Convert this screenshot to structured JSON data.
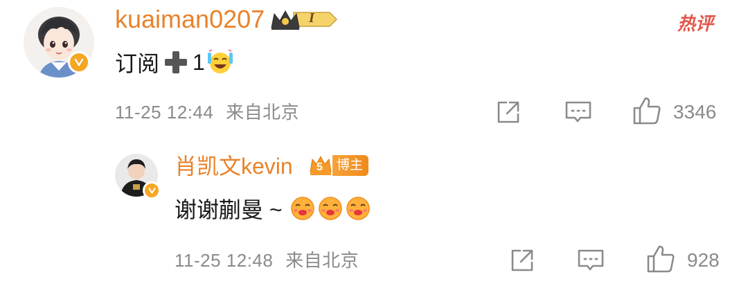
{
  "comment": {
    "username": "kuaiman0207",
    "level_badge": "I",
    "hot_label": "热评",
    "text": "订阅",
    "text_suffix": "1",
    "timestamp": "11-25 12:44",
    "location": "来自北京",
    "like_count": "3346",
    "colors": {
      "username": "#e8822a",
      "verified": "#f5a623",
      "hot": "#e2574c"
    }
  },
  "reply": {
    "username": "肖凯文kevin",
    "blogger_level": "5",
    "blogger_label": "博主",
    "text": "谢谢蒯曼 ~",
    "timestamp": "11-25 12:48",
    "location": "来自北京",
    "like_count": "928"
  },
  "icons": {
    "share": "share-icon",
    "comment": "comment-icon",
    "like": "thumbs-up-icon",
    "emoji_laugh_cry": "laugh-cry-emoji-icon",
    "emoji_kiss": "kiss-emoji-icon",
    "plus": "heavy-plus-icon",
    "crown": "crown-badge-icon"
  }
}
